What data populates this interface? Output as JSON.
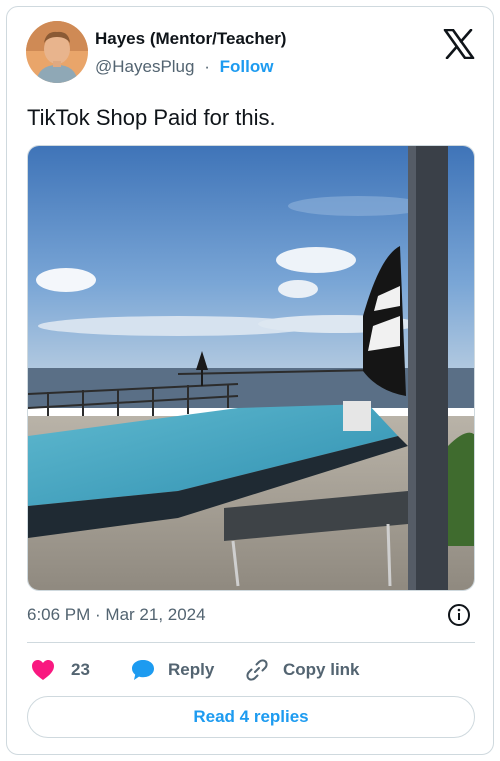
{
  "tweet": {
    "author_name": "Hayes (Mentor/Teacher)",
    "handle": "@HayesPlug",
    "separator": "·",
    "follow_label": "Follow",
    "text": "TikTok Shop Paid for this.",
    "timestamp": "6:06 PM · Mar 21, 2024",
    "media_icon": "pool-photo",
    "platform_icon": "x-logo-icon"
  },
  "actions": {
    "like_icon": "heart-icon",
    "like_count": "23",
    "reply_icon": "speech-bubble-icon",
    "reply_label": "Reply",
    "copy_icon": "link-icon",
    "copy_label": "Copy link"
  },
  "footer": {
    "read_replies_label": "Read 4 replies"
  },
  "colors": {
    "accent": "#1d9bf0",
    "like": "#f91880",
    "text": "#0f1419",
    "muted": "#536471",
    "border": "#cfd9de"
  }
}
